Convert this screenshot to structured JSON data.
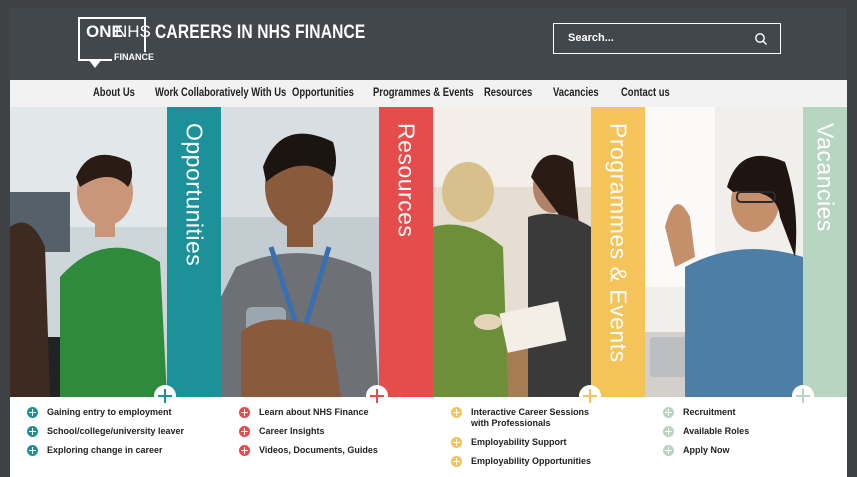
{
  "brand": {
    "one": "ONE",
    "nhs": "NHS",
    "sub": "FINANCE",
    "title": "CAREERS IN NHS FINANCE"
  },
  "search": {
    "placeholder": "Search..."
  },
  "nav": [
    "About Us",
    "Work Collaboratively With Us",
    "Opportunities",
    "Programmes & Events",
    "Resources",
    "Vacancies",
    "Contact us"
  ],
  "colors": {
    "teal": "#1d9199",
    "red": "#e74c4c",
    "yellow": "#f4c35a",
    "green": "#b7d5c0",
    "header": "#41474b"
  },
  "bands": [
    "Opportunities",
    "Resources",
    "Programmes & Events",
    "Vacancies"
  ],
  "columns": [
    {
      "items": [
        "Gaining entry to employment",
        "School/college/university leaver",
        "Exploring change in career"
      ]
    },
    {
      "items": [
        "Learn about NHS Finance",
        "Career Insights",
        "Videos, Documents, Guides"
      ]
    },
    {
      "items": [
        "Interactive Career Sessions with Professionals",
        "Employability Support",
        "Employability Opportunities"
      ]
    },
    {
      "items": [
        "Recruitment",
        "Available Roles",
        "Apply Now"
      ]
    }
  ]
}
